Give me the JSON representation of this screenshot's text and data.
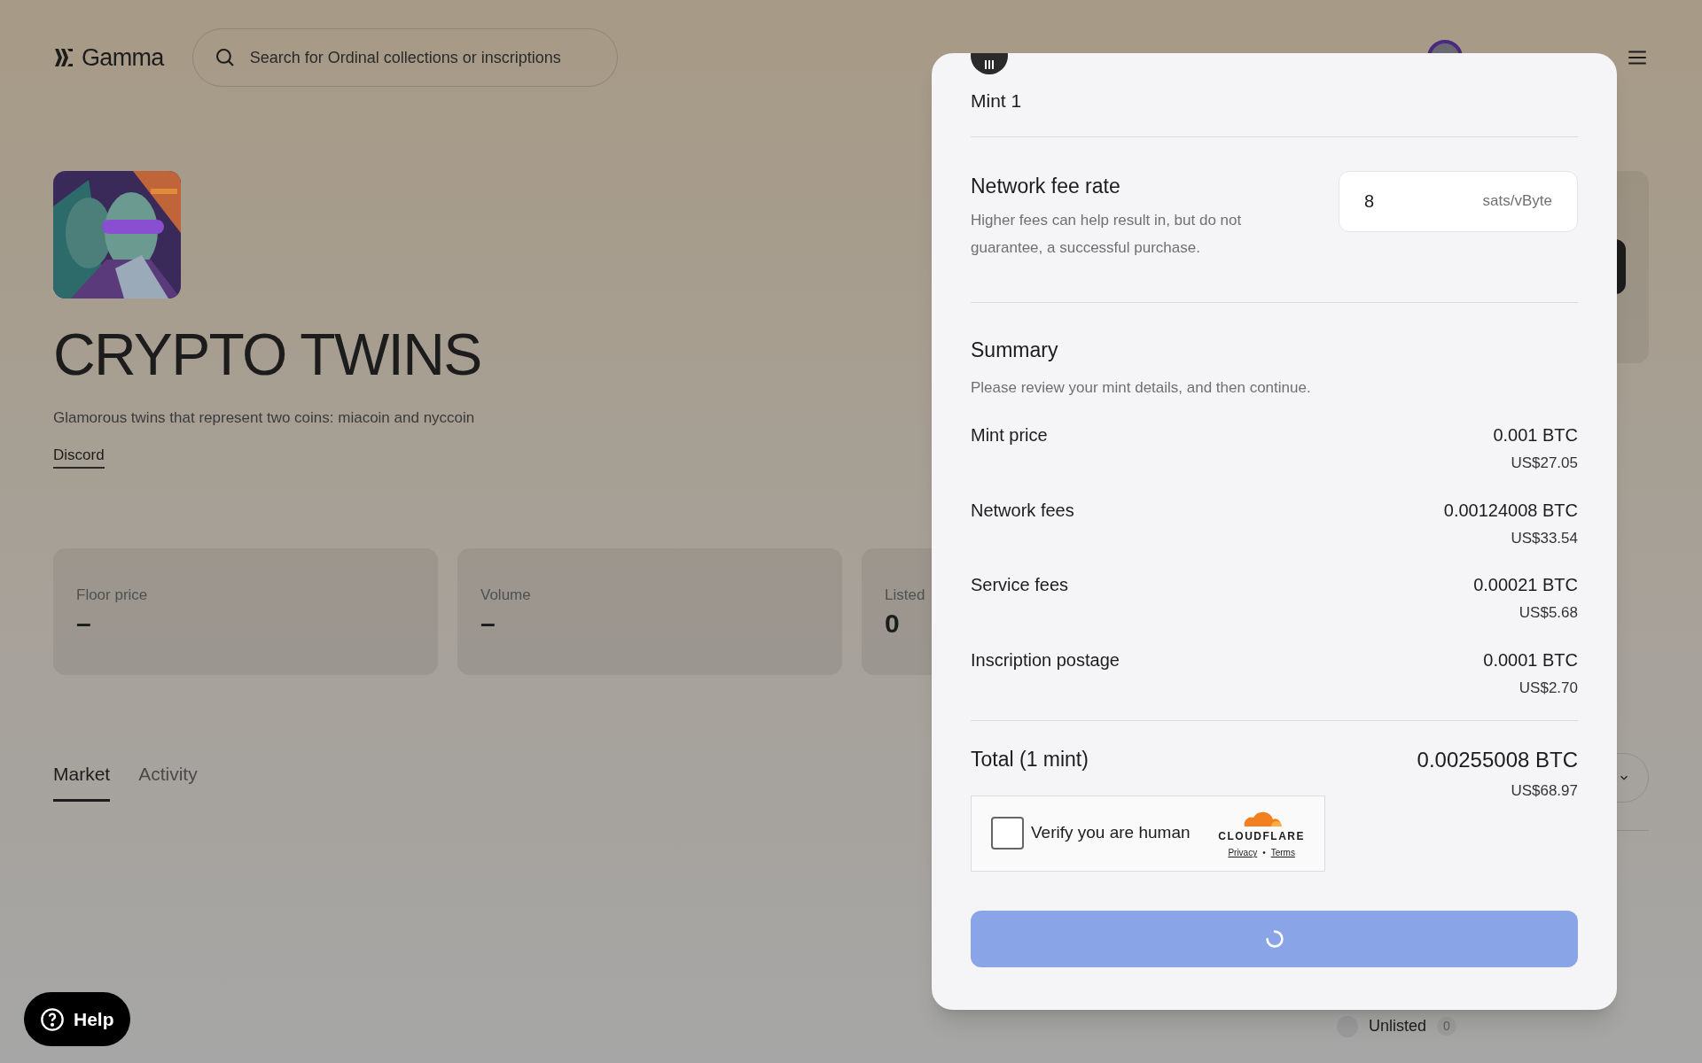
{
  "header": {
    "logo": "Gamma",
    "search": {
      "placeholder": "Search for Ordinal collections or inscriptions"
    }
  },
  "collection": {
    "title": "CRYPTO TWINS",
    "description": "Glamorous twins that represent two coins: miacoin and nyccoin",
    "link": "Discord"
  },
  "stats": [
    {
      "label": "Floor price",
      "value": "–"
    },
    {
      "label": "Volume",
      "value": "–"
    },
    {
      "label": "Listed",
      "value": "0"
    }
  ],
  "tabs": [
    {
      "label": "Market",
      "selected": true
    },
    {
      "label": "Activity",
      "selected": false
    }
  ],
  "filter": {
    "label": "Unlisted",
    "count": "0",
    "selected": false
  },
  "help_button": "Help",
  "modal": {
    "item": "Mint 1",
    "fee": {
      "title": "Network fee rate",
      "description": "Higher fees can help result in, but do not guarantee, a successful purchase.",
      "value": "8",
      "unit": "sats/vByte"
    },
    "summary": {
      "title": "Summary",
      "subtitle": "Please review your mint details, and then continue.",
      "rows": [
        {
          "label": "Mint price",
          "btc": "0.001 BTC",
          "usd": "US$27.05"
        },
        {
          "label": "Network fees",
          "btc": "0.00124008 BTC",
          "usd": "US$33.54"
        },
        {
          "label": "Service fees",
          "btc": "0.00021 BTC",
          "usd": "US$5.68"
        },
        {
          "label": "Inscription postage",
          "btc": "0.0001 BTC",
          "usd": "US$2.70"
        }
      ],
      "total": {
        "label": "Total (1 mint)",
        "btc": "0.00255008 BTC",
        "usd": "US$68.97"
      }
    },
    "captcha": {
      "label": "Verify you are human",
      "checked": false,
      "brand": "CLOUDFLARE",
      "links": [
        "Privacy",
        "Terms"
      ],
      "separator": "•"
    },
    "submit": {
      "loading": true
    }
  }
}
